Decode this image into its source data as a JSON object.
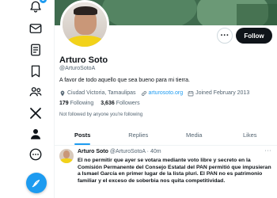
{
  "nav": {
    "notifications_badge": "3"
  },
  "profile": {
    "name": "Arturo Soto",
    "handle": "@ArturoSotoA",
    "bio": "A favor de todo aquello que sea bueno para mi tierra.",
    "location": "Ciudad Victoria, Tamaulipas",
    "website": "arturosoto.org",
    "joined": "Joined February 2013",
    "following_count": "179",
    "following_label": "Following",
    "followers_count": "3,636",
    "followers_label": "Followers",
    "followed_by_note": "Not followed by anyone you're following",
    "follow_label": "Follow",
    "more_label": "···"
  },
  "tabs": [
    "Posts",
    "Replies",
    "Media",
    "Likes"
  ],
  "tweet": {
    "name": "Arturo Soto",
    "handle": "@ArturoSotoA",
    "separator": "·",
    "time": "40m",
    "more": "···",
    "text": "El no permitir que ayer se votara mediante voto libre y secreto en la Comisión Permanente del Consejo Estatal del PAN permitió que impusieran a Ismael García en primer lugar de la lista pluri. El PAN no es patrimonio familiar y el exceso de soberbia nos quita competitividad."
  },
  "colors": {
    "accent": "#1d9bf0",
    "text": "#0f1419",
    "muted": "#536471"
  }
}
